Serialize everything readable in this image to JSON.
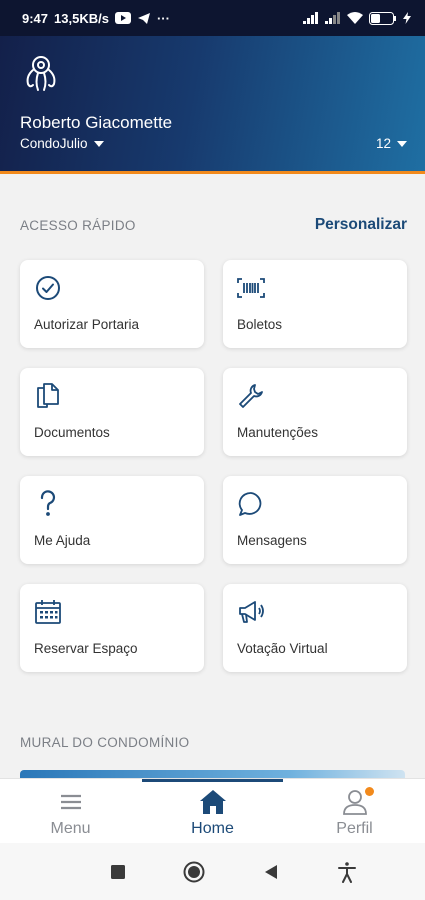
{
  "status_bar": {
    "time": "9:47",
    "speed": "13,5KB/s",
    "more": "···",
    "battery": "34"
  },
  "header": {
    "user_name": "Roberto Giacomette",
    "condo_name": "CondoJulio",
    "unit": "12",
    "accent_color": "#f28a1c"
  },
  "quick_access": {
    "title": "ACESSO RÁPIDO",
    "customize_label": "Personalizar",
    "items": [
      {
        "label": "Autorizar Portaria",
        "icon": "check-circle-icon"
      },
      {
        "label": "Boletos",
        "icon": "barcode-icon"
      },
      {
        "label": "Documentos",
        "icon": "documents-icon"
      },
      {
        "label": "Manutenções",
        "icon": "wrench-icon"
      },
      {
        "label": "Me Ajuda",
        "icon": "question-icon"
      },
      {
        "label": "Mensagens",
        "icon": "chat-bubble-icon"
      },
      {
        "label": "Reservar Espaço",
        "icon": "calendar-icon"
      },
      {
        "label": "Votação Virtual",
        "icon": "megaphone-icon"
      }
    ]
  },
  "mural": {
    "title": "MURAL DO CONDOMÍNIO"
  },
  "bottom_nav": {
    "items": [
      {
        "label": "Menu",
        "icon": "hamburger-icon"
      },
      {
        "label": "Home",
        "icon": "home-icon",
        "active": true
      },
      {
        "label": "Perfil",
        "icon": "person-icon",
        "badge": true
      }
    ]
  },
  "colors": {
    "primary": "#1c4a78",
    "header_dark": "#13204a",
    "header_light": "#1f6fa3"
  }
}
